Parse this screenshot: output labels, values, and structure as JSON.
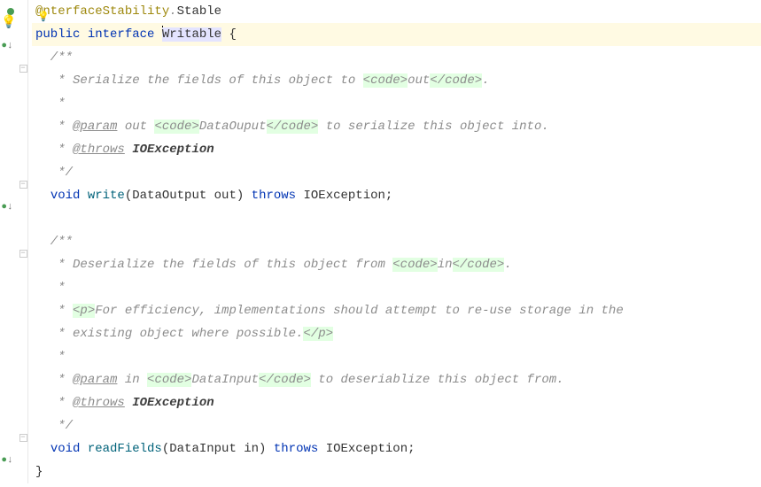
{
  "code": {
    "line1": {
      "annotation_prefix": "@",
      "annotation_text": "nterfaceStability",
      "dot": ".",
      "member": "Stable"
    },
    "line2": {
      "kw1": "public",
      "kw2": "interface",
      "name": "Writable",
      "brace": " {"
    },
    "line3": "  /**",
    "line4": {
      "prefix": "   * Serialize the fields of this object to ",
      "tag_open": "<code>",
      "content": "out",
      "tag_close": "</code>",
      "suffix": "."
    },
    "line5": "   *",
    "line6": {
      "prefix": "   * ",
      "tag": "@param",
      "name": " out ",
      "tag_open": "<code>",
      "content": "DataOuput",
      "tag_close": "</code>",
      "suffix": " to serialize this object into."
    },
    "line7": {
      "prefix": "   * ",
      "tag": "@throws",
      "name": " IOException"
    },
    "line8": "   */",
    "line9": {
      "indent": "  ",
      "kw1": "void",
      "method": " write",
      "params": "(DataOutput out) ",
      "kw2": "throws",
      "exc": " IOException;"
    },
    "line10": "",
    "line11": "  /**",
    "line12": {
      "prefix": "   * Deserialize the fields of this object from ",
      "tag_open": "<code>",
      "content": "in",
      "tag_close": "</code>",
      "suffix": "."
    },
    "line13": "   *",
    "line14": {
      "prefix": "   * ",
      "tag_open": "<p>",
      "content": "For efficiency, implementations should attempt to re-use storage in the"
    },
    "line15": {
      "prefix": "   * existing object where possible.",
      "tag_close": "</p>"
    },
    "line16": "   *",
    "line17": {
      "prefix": "   * ",
      "tag": "@param",
      "name": " in ",
      "tag_open": "<code>",
      "content": "DataInput",
      "tag_close": "</code>",
      "suffix": " to deseriablize this object from."
    },
    "line18": {
      "prefix": "   * ",
      "tag": "@throws",
      "name": " IOException"
    },
    "line19": "   */",
    "line20": {
      "indent": "  ",
      "kw1": "void",
      "method": " readFields",
      "params": "(DataInput in) ",
      "kw2": "throws",
      "exc": " IOException;"
    },
    "line21": "}"
  }
}
